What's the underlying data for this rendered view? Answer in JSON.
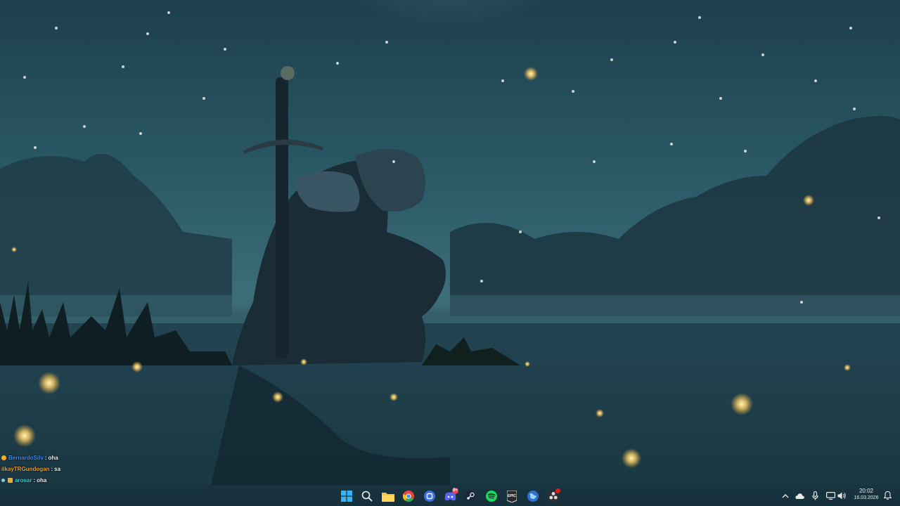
{
  "wallpaper": {
    "description_icon": "knight-kneeling-by-sword-wallpaper",
    "palette": {
      "sky": "#2a5763",
      "fog": "#3c6f7a",
      "water": "#244755",
      "firefly": "#ffd77a"
    }
  },
  "chat": {
    "lines": [
      {
        "user": "BernardoSilv",
        "sep": ":",
        "message": "oha",
        "user_color": "#3f8ef5"
      },
      {
        "user": "ilkayTRGundogan",
        "sep": ":",
        "message": "sa",
        "user_color": "#f0a030"
      },
      {
        "user": "arosar",
        "sep": ":",
        "message": "oha",
        "user_color": "#43d3e0"
      }
    ]
  },
  "taskbar": {
    "icons": [
      {
        "name": "windows-start-icon"
      },
      {
        "name": "search-icon"
      },
      {
        "name": "file-explorer-icon"
      },
      {
        "name": "chrome-icon"
      },
      {
        "name": "app-blue-icon"
      },
      {
        "name": "discord-icon",
        "badge": "9+"
      },
      {
        "name": "steam-icon"
      },
      {
        "name": "spotify-icon"
      },
      {
        "name": "epic-games-icon"
      },
      {
        "name": "app-globe-icon"
      },
      {
        "name": "obs-icon"
      }
    ],
    "tray": {
      "icons": [
        "chevron-up-icon",
        "cloud-icon",
        "microphone-icon",
        "network-icon",
        "volume-icon",
        "notification-icon"
      ],
      "time": "20:02",
      "date": "16.03.2026"
    }
  }
}
